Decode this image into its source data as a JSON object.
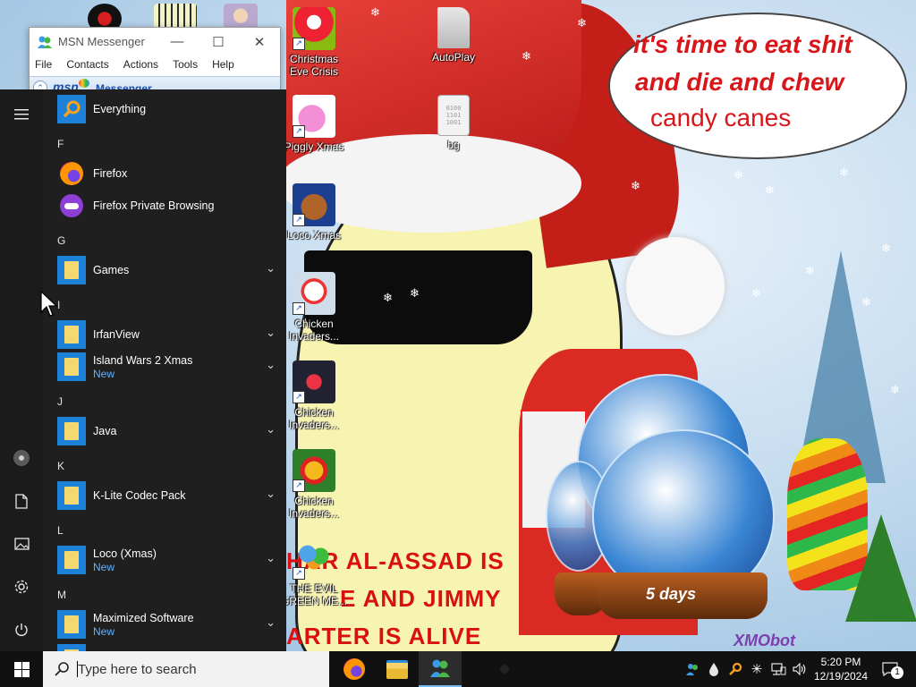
{
  "wallpaper": {
    "speech_line1": "it's time to eat shit",
    "speech_line2": "and die and chew",
    "speech_line3": "candy canes",
    "caption_line1": "HAR AL-ASSAD IS",
    "caption_line2": "E AND JIMMY",
    "caption_line3": "ARTER IS ALIVE",
    "countdown": "5 days",
    "signature": "XMObot"
  },
  "desktop_icons": [
    {
      "label": "Christmas Eve Crisis"
    },
    {
      "label": "AutoPlay"
    },
    {
      "label": "Piggly Xmas"
    },
    {
      "label": "bg",
      "binary": "0100\n1101\n1001"
    },
    {
      "label": "Loco Xmas"
    },
    {
      "label": "Chicken Invaders..."
    },
    {
      "label": "Chicken Invaders..."
    },
    {
      "label": "Chicken Invaders..."
    },
    {
      "label": "THE EVIL GREEN ME..."
    }
  ],
  "msn": {
    "title": "MSN Messenger",
    "menu": [
      "File",
      "Contacts",
      "Actions",
      "Tools",
      "Help"
    ],
    "brand_logo": "msn",
    "brand_name": "Messenger"
  },
  "start_menu": {
    "items": [
      {
        "type": "app",
        "label": "Everything",
        "icon": "everything-search-icon"
      },
      {
        "type": "letter",
        "label": "F"
      },
      {
        "type": "app",
        "label": "Firefox",
        "icon": "firefox-icon"
      },
      {
        "type": "app",
        "label": "Firefox Private Browsing",
        "icon": "firefox-private-icon"
      },
      {
        "type": "letter",
        "label": "G"
      },
      {
        "type": "folder",
        "label": "Games"
      },
      {
        "type": "letter",
        "label": "I"
      },
      {
        "type": "folder",
        "label": "IrfanView"
      },
      {
        "type": "folder",
        "label": "Island Wars 2 Xmas",
        "sub": "New"
      },
      {
        "type": "letter",
        "label": "J"
      },
      {
        "type": "folder",
        "label": "Java"
      },
      {
        "type": "letter",
        "label": "K"
      },
      {
        "type": "folder",
        "label": "K-Lite Codec Pack"
      },
      {
        "type": "letter",
        "label": "L"
      },
      {
        "type": "folder",
        "label": "Loco (Xmas)",
        "sub": "New"
      },
      {
        "type": "letter",
        "label": "M"
      },
      {
        "type": "folder",
        "label": "Maximized Software",
        "sub": "New"
      }
    ]
  },
  "taskbar": {
    "search_placeholder": "Type here to search",
    "time": "5:20 PM",
    "date": "12/19/2024",
    "notification_count": "1"
  }
}
